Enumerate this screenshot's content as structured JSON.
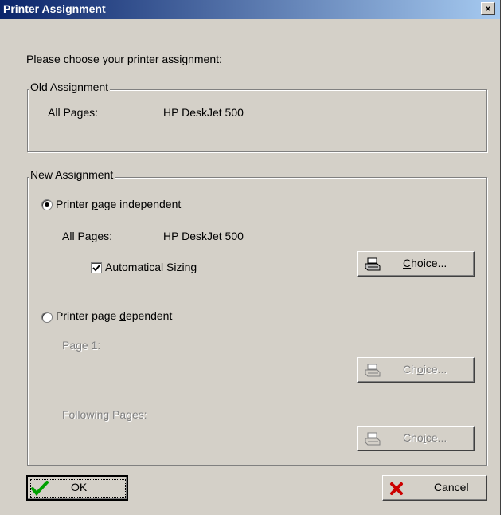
{
  "dialog": {
    "title": "Printer Assignment",
    "close_glyph": "×",
    "prompt": "Please choose your printer assignment:"
  },
  "old_assignment": {
    "legend": "Old Assignment",
    "label": "All Pages:",
    "value": "HP DeskJet 500"
  },
  "new_assignment": {
    "legend": "New Assignment",
    "independent": {
      "pre": "Printer ",
      "key": "p",
      "post": "age independent",
      "selected": true,
      "all_pages_label": "All Pages:",
      "all_pages_value": "HP DeskJet 500",
      "auto_sizing_label": "Automatical Sizing",
      "auto_sizing_checked": true,
      "choice_label_key": "C",
      "choice_label_rest": "hoice..."
    },
    "dependent": {
      "pre": "Printer page ",
      "key": "d",
      "post": "ependent",
      "selected": false,
      "page1_label": "Page 1:",
      "page1_choice_pre": "Ch",
      "page1_choice_key": "o",
      "page1_choice_post": "ice...",
      "following_label": "Following Pages:",
      "following_choice_pre": "Cho",
      "following_choice_key": "i",
      "following_choice_post": "ce..."
    }
  },
  "buttons": {
    "ok": "OK",
    "cancel": "Cancel"
  },
  "icons": {
    "ok": "checkmark-icon",
    "cancel": "x-icon",
    "choice": "printer-icon"
  }
}
